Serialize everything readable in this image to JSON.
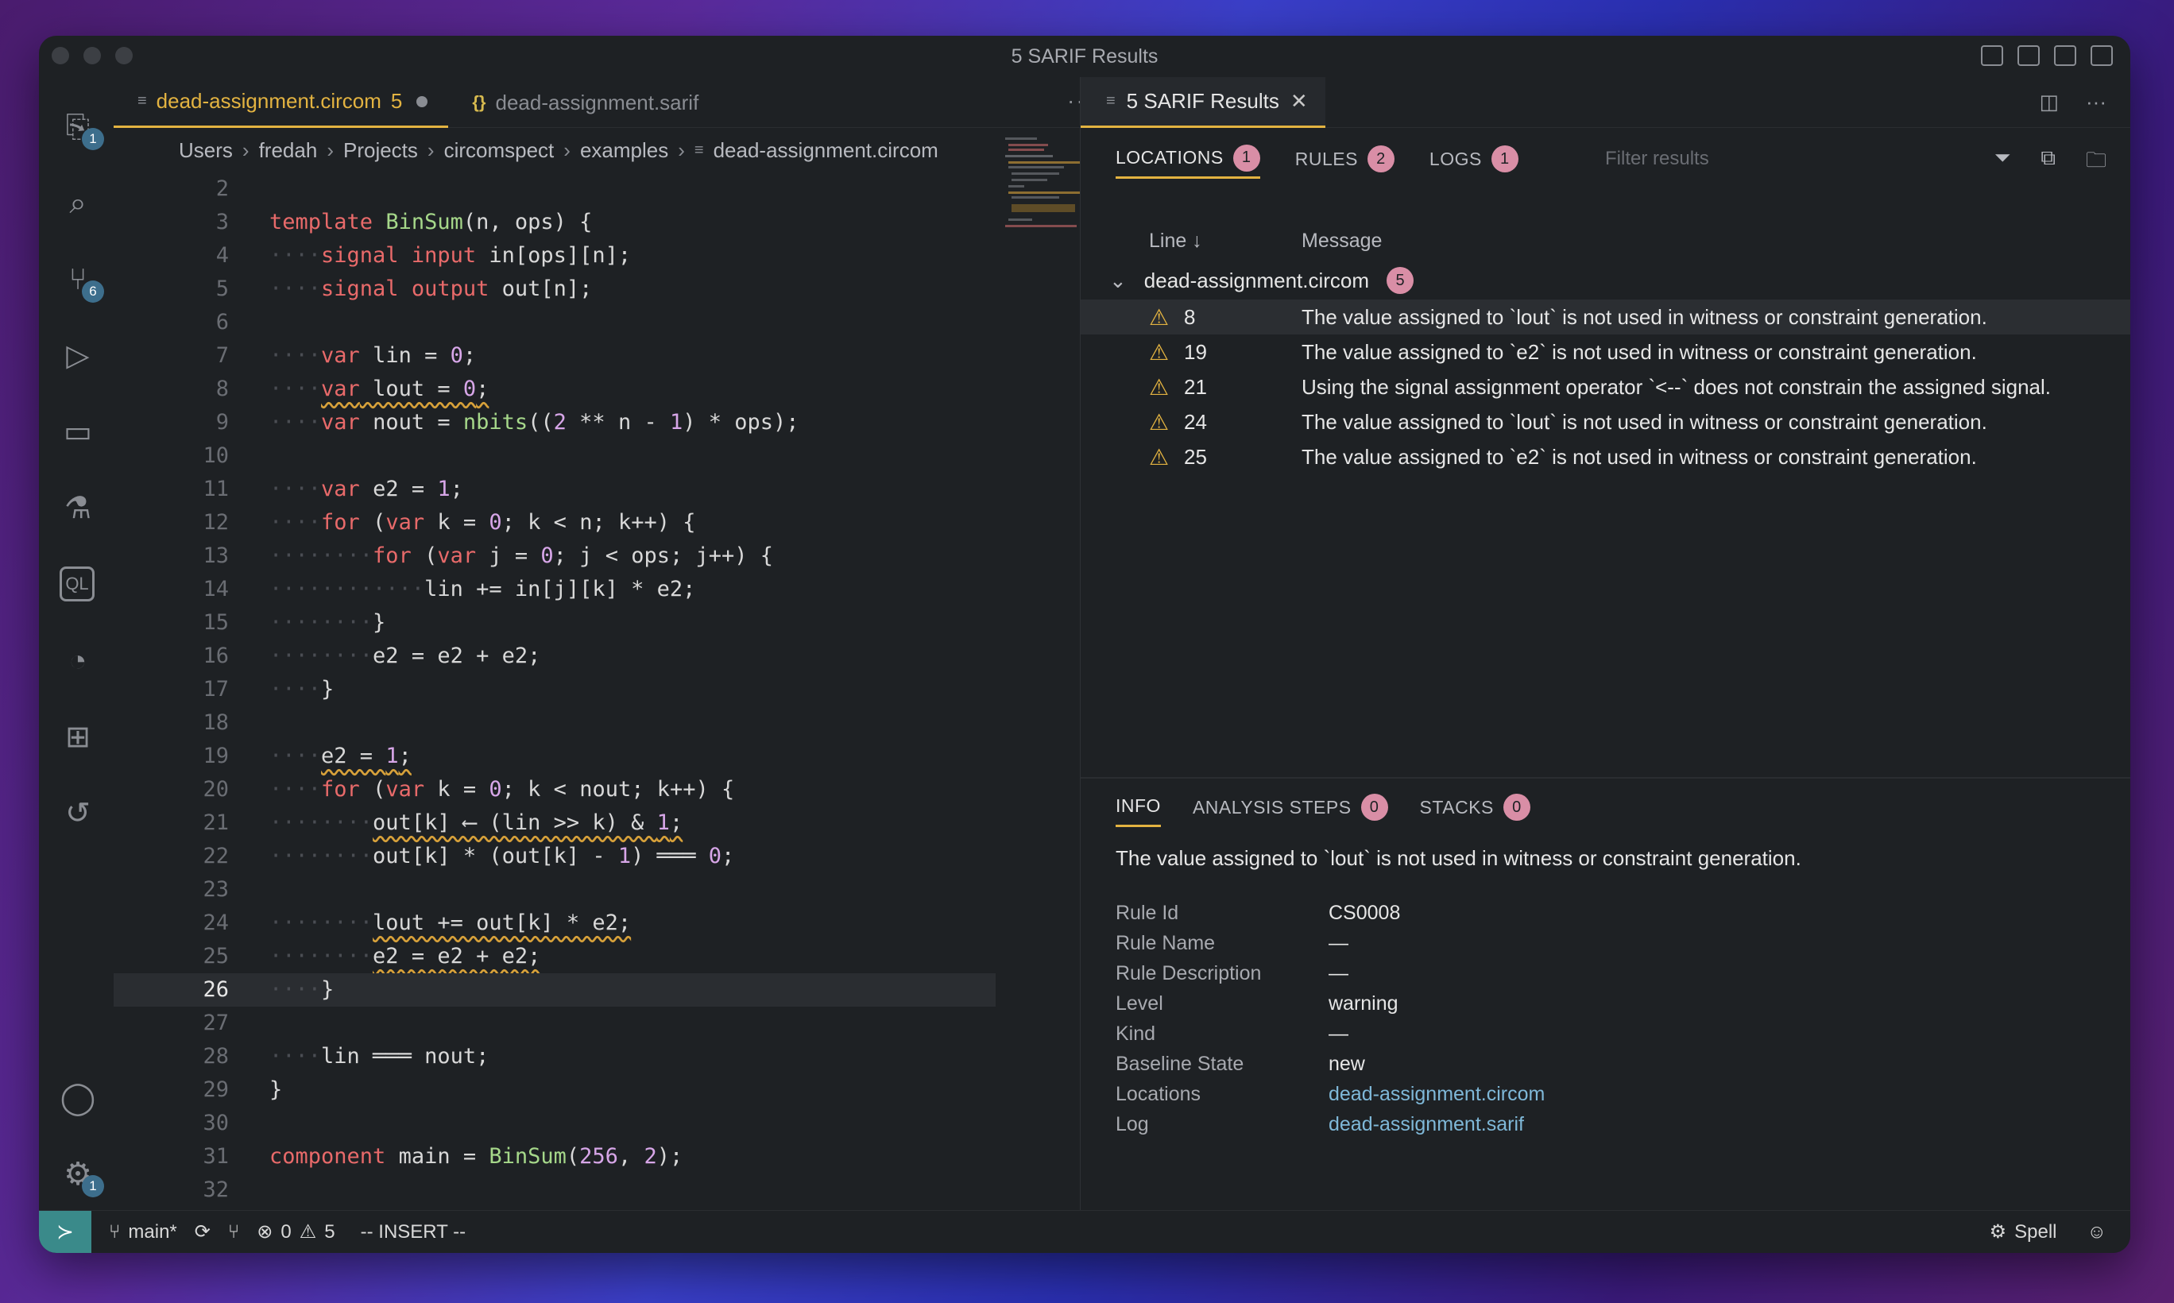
{
  "window": {
    "title": "5 SARIF Results"
  },
  "activity_bar": {
    "items": [
      {
        "name": "explorer-icon",
        "badge": "1"
      },
      {
        "name": "search-icon",
        "badge": ""
      },
      {
        "name": "source-control-icon",
        "badge": "6"
      },
      {
        "name": "run-debug-icon",
        "badge": ""
      },
      {
        "name": "remote-explorer-icon",
        "badge": ""
      },
      {
        "name": "testing-icon",
        "badge": ""
      },
      {
        "name": "codeql-icon",
        "badge": ""
      },
      {
        "name": "git-graph-icon",
        "badge": ""
      },
      {
        "name": "extensions-icon",
        "badge": ""
      },
      {
        "name": "history-icon",
        "badge": ""
      }
    ],
    "bottom": [
      {
        "name": "accounts-icon",
        "badge": ""
      },
      {
        "name": "settings-gear-icon",
        "badge": "1"
      }
    ]
  },
  "editor": {
    "tabs": [
      {
        "label": "dead-assignment.circom",
        "count": "5",
        "active": true
      },
      {
        "label": "dead-assignment.sarif",
        "count": "",
        "active": false
      }
    ],
    "more_label": "···",
    "breadcrumb": [
      "Users",
      "fredah",
      "Projects",
      "circomspect",
      "examples",
      "dead-assignment.circom"
    ],
    "lines": [
      {
        "n": "2",
        "t": ""
      },
      {
        "n": "3",
        "t": "template BinSum(n, ops) {"
      },
      {
        "n": "4",
        "t": "····signal input in[ops][n];"
      },
      {
        "n": "5",
        "t": "····signal output out[n];"
      },
      {
        "n": "6",
        "t": ""
      },
      {
        "n": "7",
        "t": "····var lin = 0;"
      },
      {
        "n": "8",
        "t": "····var lout = 0;"
      },
      {
        "n": "9",
        "t": "····var nout = nbits((2 ** n - 1) * ops);"
      },
      {
        "n": "10",
        "t": ""
      },
      {
        "n": "11",
        "t": "····var e2 = 1;"
      },
      {
        "n": "12",
        "t": "····for (var k = 0; k < n; k++) {"
      },
      {
        "n": "13",
        "t": "········for (var j = 0; j < ops; j++) {"
      },
      {
        "n": "14",
        "t": "············lin += in[j][k] * e2;"
      },
      {
        "n": "15",
        "t": "········}"
      },
      {
        "n": "16",
        "t": "········e2 = e2 + e2;"
      },
      {
        "n": "17",
        "t": "····}"
      },
      {
        "n": "18",
        "t": ""
      },
      {
        "n": "19",
        "t": "····e2 = 1;"
      },
      {
        "n": "20",
        "t": "····for (var k = 0; k < nout; k++) {"
      },
      {
        "n": "21",
        "t": "········out[k] ⟵ (lin >> k) & 1;"
      },
      {
        "n": "22",
        "t": "········out[k] * (out[k] - 1) ═══ 0;"
      },
      {
        "n": "23",
        "t": ""
      },
      {
        "n": "24",
        "t": "········lout += out[k] * e2;"
      },
      {
        "n": "25",
        "t": "········e2 = e2 + e2;"
      },
      {
        "n": "26",
        "t": "····}"
      },
      {
        "n": "27",
        "t": ""
      },
      {
        "n": "28",
        "t": "····lin ═══ nout;"
      },
      {
        "n": "29",
        "t": "}"
      },
      {
        "n": "30",
        "t": ""
      },
      {
        "n": "31",
        "t": "component main = BinSum(256, 2);"
      },
      {
        "n": "32",
        "t": ""
      }
    ]
  },
  "sarif": {
    "tab_label": "5 SARIF Results",
    "subtabs": [
      {
        "label": "LOCATIONS",
        "count": "1"
      },
      {
        "label": "RULES",
        "count": "2"
      },
      {
        "label": "LOGS",
        "count": "1"
      }
    ],
    "filter_placeholder": "Filter results",
    "columns": {
      "line": "Line ↓",
      "message": "Message"
    },
    "group": {
      "file": "dead-assignment.circom",
      "count": "5"
    },
    "results": [
      {
        "line": "8",
        "message": "The value assigned to `lout` is not used in witness or constraint generation."
      },
      {
        "line": "19",
        "message": "The value assigned to `e2` is not used in witness or constraint generation."
      },
      {
        "line": "21",
        "message": "Using the signal assignment operator `<--` does not constrain the assigned signal."
      },
      {
        "line": "24",
        "message": "The value assigned to `lout` is not used in witness or constraint generation."
      },
      {
        "line": "25",
        "message": "The value assigned to `e2` is not used in witness or constraint generation."
      }
    ],
    "info_tabs": [
      {
        "label": "INFO",
        "count": ""
      },
      {
        "label": "ANALYSIS STEPS",
        "count": "0"
      },
      {
        "label": "STACKS",
        "count": "0"
      }
    ],
    "info": {
      "message": "The value assigned to `lout` is not used in witness or constraint generation.",
      "props": [
        {
          "k": "Rule Id",
          "v": "CS0008",
          "link": false
        },
        {
          "k": "Rule Name",
          "v": "—",
          "link": false
        },
        {
          "k": "Rule Description",
          "v": "—",
          "link": false
        },
        {
          "k": "Level",
          "v": "warning",
          "link": false
        },
        {
          "k": "Kind",
          "v": "—",
          "link": false
        },
        {
          "k": "Baseline State",
          "v": "new",
          "link": false
        },
        {
          "k": "Locations",
          "v": "dead-assignment.circom",
          "link": true
        },
        {
          "k": "Log",
          "v": "dead-assignment.sarif",
          "link": true
        }
      ]
    }
  },
  "status": {
    "branch": "main*",
    "errors": "0",
    "warnings": "5",
    "mode": "-- INSERT --",
    "spell": "Spell"
  },
  "colors": {
    "accent": "#e3b341",
    "badge": "#d98ea6",
    "link": "#7fb8d8"
  }
}
